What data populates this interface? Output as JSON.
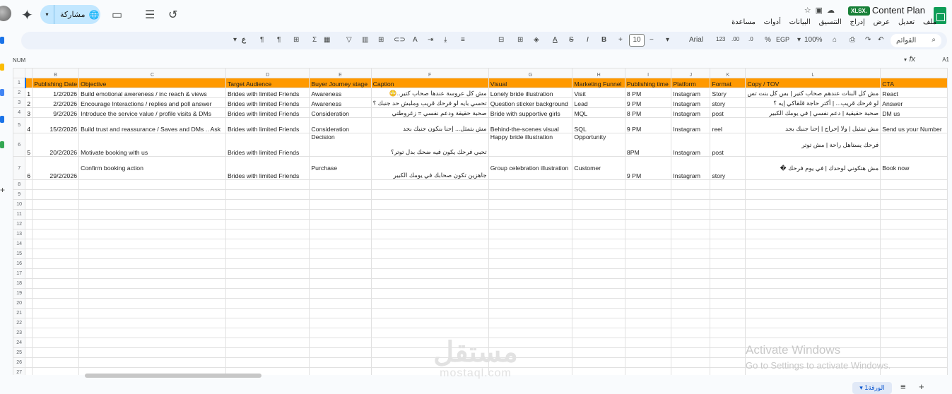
{
  "app": {
    "doc_title": "Content Plan",
    "file_badge": "XLSX.",
    "share_label": "مشاركة",
    "menu": [
      "ملف",
      "تعديل",
      "عرض",
      "إدراج",
      "التنسيق",
      "البيانات",
      "أدوات",
      "مساعدة"
    ]
  },
  "toolbar": {
    "search_placeholder": "القوائم",
    "zoom": "100%",
    "currency": "EGP",
    "percent": "%",
    "decimal_dec": ".0",
    "decimal_inc": ".00",
    "number_format": "123",
    "font": "Arial",
    "font_size": "10"
  },
  "formula_bar": {
    "name_box": "NUM",
    "cell_ref": "A1",
    "fx": "fx"
  },
  "grid": {
    "columns": [
      "B",
      "C",
      "D",
      "E",
      "F",
      "G",
      "H",
      "I",
      "J",
      "K",
      "L"
    ],
    "header_row": [
      "Publishing Date",
      "Objective",
      "Target Audience",
      "Buyer Journey stage",
      "Caption",
      "Visual",
      "Marketing Funnel",
      "Publishing time",
      "Platform",
      "Format",
      "Copy / TOV",
      "CTA"
    ],
    "rows": [
      {
        "n": "1",
        "date": "1/2/2026",
        "objective": "Build emotional awereness / inc reach & views",
        "audience": "Brides with limited Friends",
        "stage": "Awareness",
        "caption": "مش كل عروسة عندها صحاب كتير..😳",
        "visual": "Lonely bride illustration",
        "funnel": "Visit",
        "time": "8 PM",
        "platform": "Instagram",
        "format": "Story",
        "copy": "مش كل البنات عندهم صحاب كتير | بس كل بنت تس",
        "cta": "React"
      },
      {
        "n": "2",
        "date": "2/2/2026",
        "objective": "Encourage Interactions / replies and poll answer",
        "audience": "Brides with limited Friends",
        "stage": "Awareness",
        "caption": "تحسي بايه لو فرحك قريب وملبش حد جنبك ؟",
        "visual": "Question sticker background",
        "funnel": "Lead",
        "time": "9 PM",
        "platform": "Instagram",
        "format": "story",
        "copy": "لو فرحك قريب... | أكتر حاجة قلقاكي إيه ؟",
        "cta": "Answer"
      },
      {
        "n": "3",
        "date": "9/2/2026",
        "objective": "Introduce the service value / profile visits & DMs",
        "audience": "Brides with limited Friends",
        "stage": "Consideration",
        "caption": "صحبة حقيقة ودعم نفسي = زغروطتي",
        "visual": "Bride with supportive girls",
        "funnel": "MQL",
        "time": "8 PM",
        "platform": "Instagram",
        "format": "post",
        "copy": "صحبة حقيقية | دعم نفسي | في يومك الكبير",
        "cta": "DM us"
      },
      {
        "n": "4",
        "date": "15/2/2026",
        "objective": "Build trust and reassurance  / Saves and DMs .. Ask",
        "audience": "Brides with limited Friends",
        "stage": "Consideration",
        "caption": "مش بتمثل... إحنا بنكون جنبك بجد",
        "visual": "Behind-the-scenes visual",
        "funnel": "SQL",
        "time": "9 PM",
        "platform": "Instagram",
        "format": "reel",
        "copy": "مش تمثيل | ولا إحراج | إحنا جنبك بجد",
        "cta": "Send us your Number"
      },
      {
        "n": "5",
        "date": "20/2/2026",
        "objective": "Motivate booking with us",
        "audience": "Brides with limited Friends",
        "stage": "Decision",
        "caption": "تحبي فرحك يكون فيه ضحك بدل توتر؟",
        "visual": "Happy bride illustration",
        "funnel": "Opportunity",
        "time": "8PM",
        "platform": "Instagram",
        "format": "post",
        "copy": "فرحك يستاهل راحة | مش توتر",
        "cta": ""
      },
      {
        "n": "6",
        "date": "29/2/2026",
        "objective": "Confirm booking action",
        "audience": "Brides with limited Friends",
        "stage": "Purchase",
        "caption": "جاهزين تكون صحابك في يومك الكبير",
        "visual": "Group celebration illustration",
        "funnel": "Customer",
        "time": "9 PM",
        "platform": "Instagram",
        "format": "story",
        "copy": "مش هتكوني لوحدك | في يوم فرحك �",
        "cta": "Book now"
      }
    ]
  },
  "sheet_tab": "الورقة1",
  "overlay": {
    "activate_title": "Activate Windows",
    "activate_sub": "Go to Settings to activate Windows.",
    "watermark_ar": "مستقل",
    "watermark_en": "mostaql.com"
  },
  "colors": {
    "header_fill": "#ff9900",
    "share_bg": "#c2e7ff",
    "sheets_green": "#0f9d58"
  }
}
